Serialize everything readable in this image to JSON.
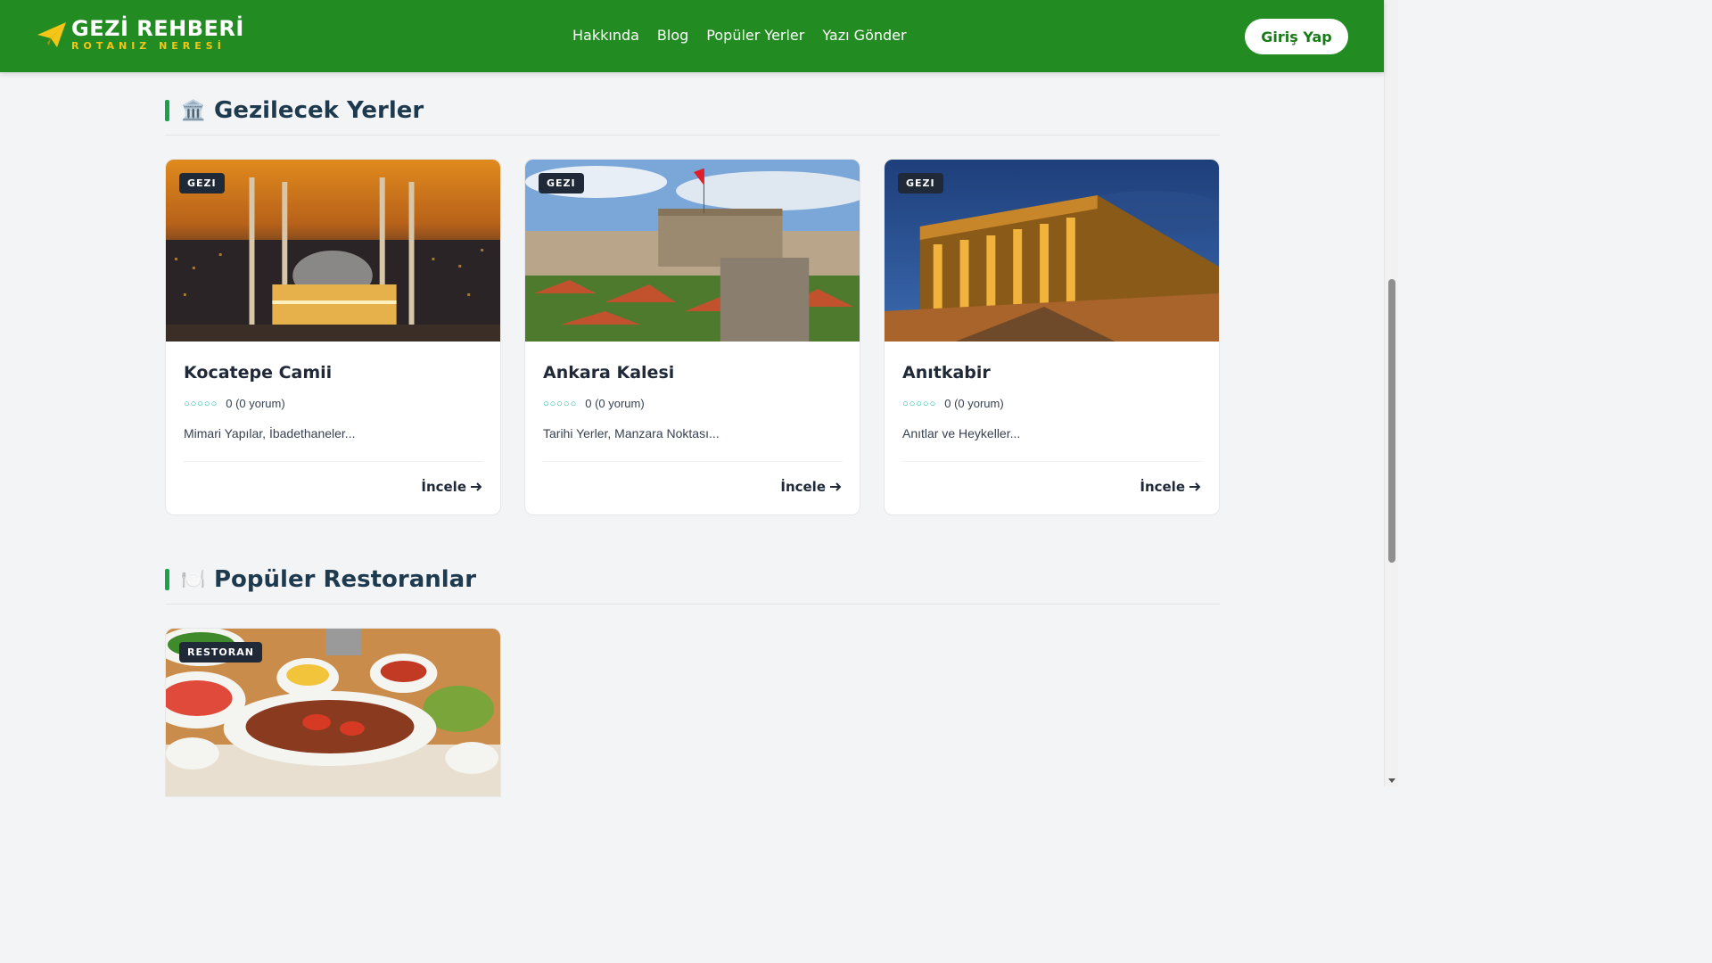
{
  "brand": {
    "title": "GEZİ REHBERİ",
    "subtitle": "ROTANIZ NERESİ",
    "icon": "paper-plane-icon",
    "colors": {
      "header": "#228b22",
      "accent": "#f5c518"
    }
  },
  "nav": {
    "items": [
      "Hakkında",
      "Blog",
      "Popüler Yerler",
      "Yazı Gönder"
    ]
  },
  "login": {
    "label": "Giriş Yap"
  },
  "sections": [
    {
      "emoji": "🏛️",
      "title": "Gezilecek Yerler",
      "cards": [
        {
          "badge": "GEZI",
          "title": "Kocatepe Camii",
          "stars": "○○○○○",
          "rating": "0 (0 yorum)",
          "desc": "Mimari Yapılar, İbadethaneler...",
          "link": "İncele",
          "image": "mosque-night-photo"
        },
        {
          "badge": "GEZI",
          "title": "Ankara Kalesi",
          "stars": "○○○○○",
          "rating": "0 (0 yorum)",
          "desc": "Tarihi Yerler, Manzara Noktası...",
          "link": "İncele",
          "image": "castle-photo"
        },
        {
          "badge": "GEZI",
          "title": "Anıtkabir",
          "stars": "○○○○○",
          "rating": "0 (0 yorum)",
          "desc": "Anıtlar ve Heykeller...",
          "link": "İncele",
          "image": "mausoleum-photo"
        }
      ]
    },
    {
      "emoji": "🍽️",
      "title": "Popüler Restoranlar",
      "cards": [
        {
          "badge": "RESTORAN",
          "image": "food-plate-photo"
        }
      ]
    }
  ]
}
